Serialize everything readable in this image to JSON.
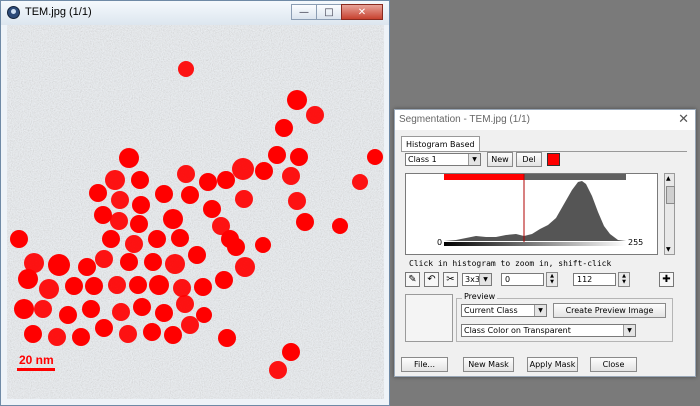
{
  "image_window": {
    "title": "TEM.jpg (1/1)",
    "scale_bar_label": "20 nm",
    "overlay_color": "#ff0000"
  },
  "segmentation_window": {
    "title": "Segmentation - TEM.jpg (1/1)",
    "tab_label": "Histogram Based",
    "class_select": "Class 1",
    "new_button": "New",
    "del_button": "Del",
    "class_color": "#ff0000",
    "histogram": {
      "min_label": "0",
      "max_label": "255"
    },
    "hint_text": "Click in histogram to zoom in, shift-click",
    "kernel_select": "3x3",
    "range_min": "0",
    "range_max": "112",
    "preview": {
      "group_label": "Preview",
      "mode_select": "Current Class",
      "create_button": "Create Preview Image",
      "style_select": "Class Color on Transparent"
    },
    "buttons": {
      "file": "File...",
      "new_mask": "New Mask",
      "apply_mask": "Apply Mask",
      "close": "Close"
    }
  }
}
